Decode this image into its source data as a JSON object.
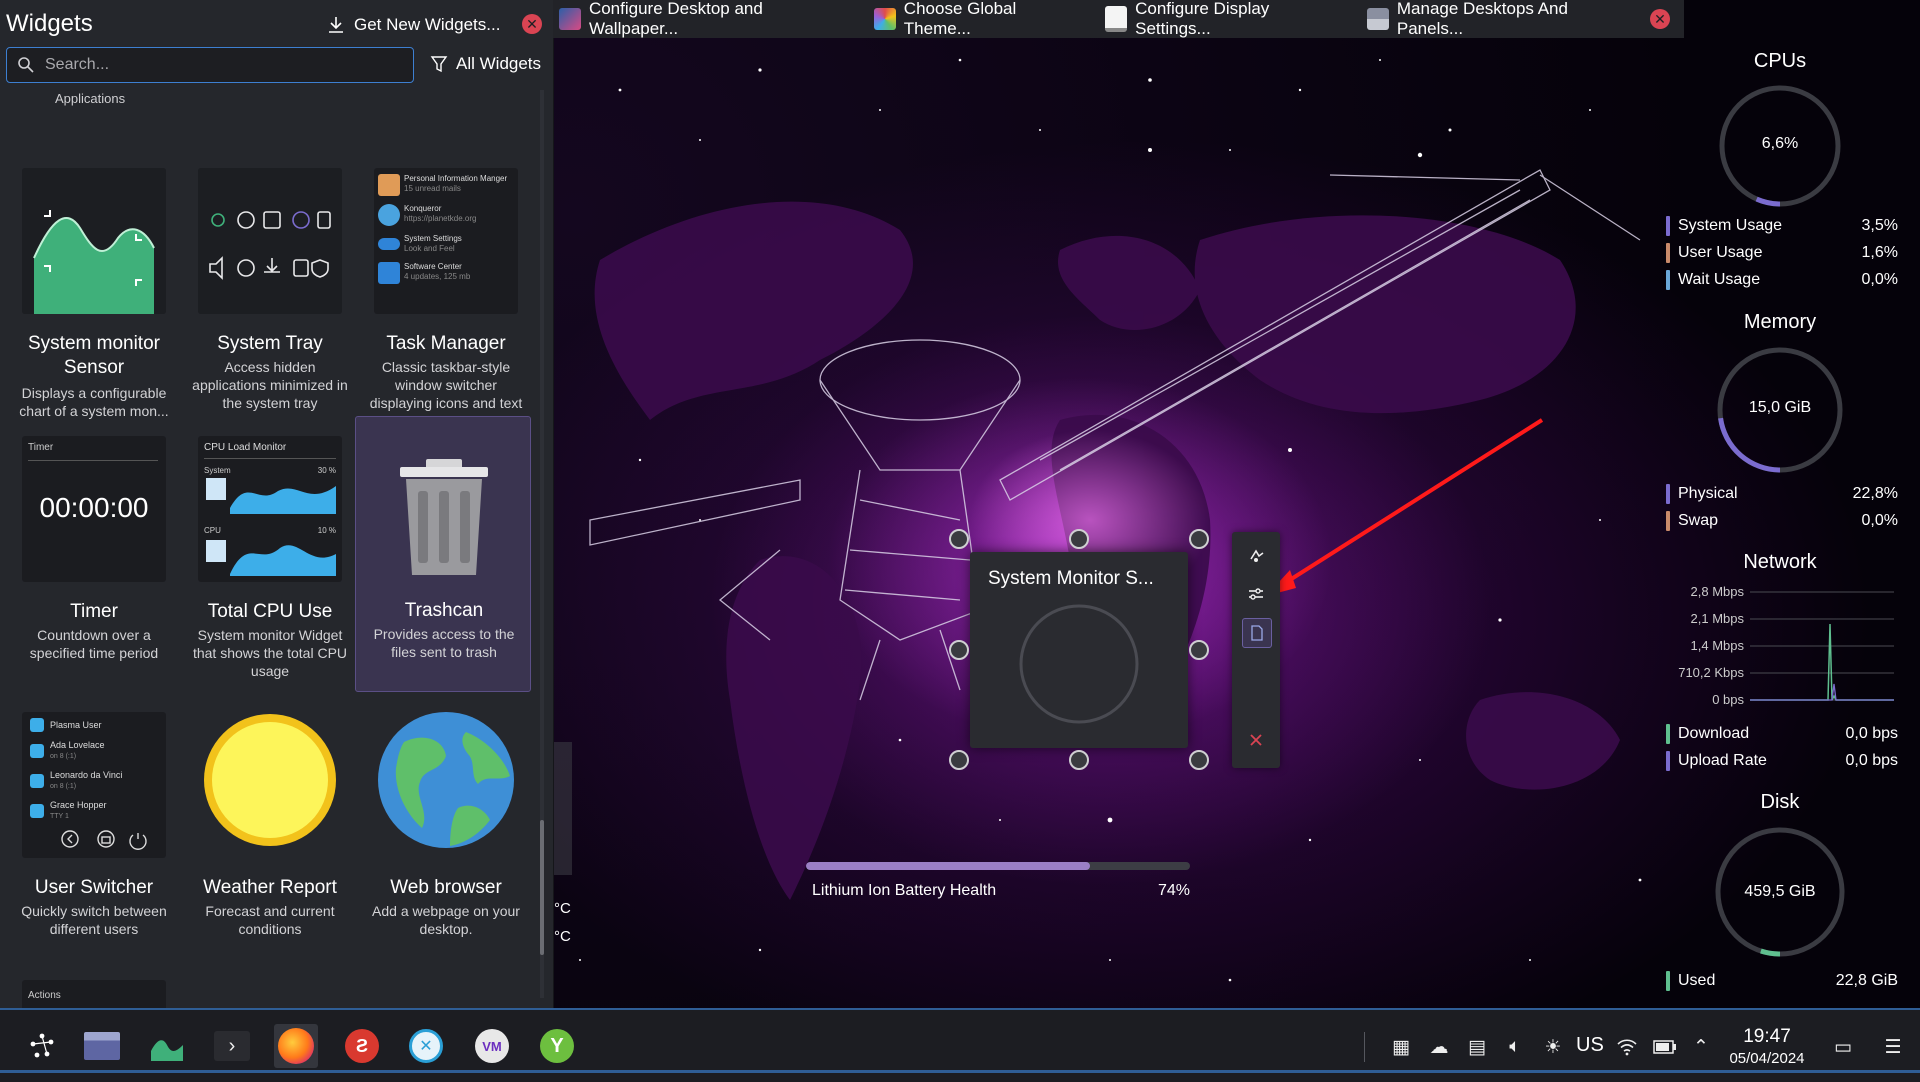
{
  "widgets_panel": {
    "title": "Widgets",
    "get_new_label": "Get New Widgets...",
    "close_symbol": "✕",
    "search_placeholder": "Search...",
    "filter_label": "All Widgets",
    "category_label": "Applications",
    "bottom_category_label": "Actions",
    "tiles": [
      {
        "name": "System monitor Sensor",
        "description": "Displays a configurable chart of a system mon..."
      },
      {
        "name": "System Tray",
        "description": "Access hidden applications minimized in the system tray"
      },
      {
        "name": "Task Manager",
        "description": "Classic taskbar-style window switcher displaying icons and text"
      },
      {
        "name": "Timer",
        "description": "Countdown over a specified time period"
      },
      {
        "name": "Total CPU Use",
        "description": "System monitor Widget that shows the total CPU usage"
      },
      {
        "name": "Trashcan",
        "description": "Provides access to the files sent to trash"
      },
      {
        "name": "User Switcher",
        "description": "Quickly switch between different users"
      },
      {
        "name": "Weather Report",
        "description": "Forecast and current conditions"
      },
      {
        "name": "Web browser",
        "description": "Add a webpage on your desktop."
      }
    ],
    "thumbs": {
      "timer_header": "Timer",
      "timer_value": "00:00:00",
      "cpu_title": "CPU Load Monitor",
      "cpu_system_label": "System",
      "cpu_system_value": "30 %",
      "cpu_cpu_label": "CPU",
      "cpu_cpu_value": "10 %",
      "task_items": [
        {
          "title": "Personal Information Manger",
          "sub": "15 unread mails"
        },
        {
          "title": "Konqueror",
          "sub": "https://planetkde.org"
        },
        {
          "title": "System Settings",
          "sub": "Look and Feel"
        },
        {
          "title": "Software Center",
          "sub": "4 updates, 125 mb"
        }
      ],
      "user_items": [
        {
          "title": "Plasma User",
          "sub": ""
        },
        {
          "title": "Ada Lovelace",
          "sub": "on 8 (:1)"
        },
        {
          "title": "Leonardo da Vinci",
          "sub": "on 8 (:1)"
        },
        {
          "title": "Grace Hopper",
          "sub": "TTY 1"
        }
      ]
    }
  },
  "window_strip": {
    "items": [
      {
        "label": "Configure Desktop and Wallpaper..."
      },
      {
        "label": "Choose Global Theme..."
      },
      {
        "label": "Configure Display Settings..."
      },
      {
        "label": "Manage Desktops And Panels..."
      }
    ],
    "close_symbol": "✕"
  },
  "sensor_widget": {
    "title": "System Monitor S..."
  },
  "battery": {
    "label": "Lithium Ion Battery Health",
    "value_text": "74%",
    "value": 74
  },
  "temp_fragment": [
    "°C",
    "°C"
  ],
  "sysmon": {
    "cpus": {
      "heading": "CPUs",
      "gauge_text": "6,6%",
      "gauge_value": 6.6,
      "rows": [
        {
          "label": "System Usage",
          "value": "3,5%",
          "color": "#7b6ccf"
        },
        {
          "label": "User Usage",
          "value": "1,6%",
          "color": "#c98a6a"
        },
        {
          "label": "Wait Usage",
          "value": "0,0%",
          "color": "#6aa7d8"
        }
      ]
    },
    "memory": {
      "heading": "Memory",
      "gauge_text": "15,0 GiB",
      "gauge_value": 22.8,
      "rows": [
        {
          "label": "Physical",
          "value": "22,8%",
          "color": "#7b6ccf"
        },
        {
          "label": "Swap",
          "value": "0,0%",
          "color": "#c98a6a"
        }
      ]
    },
    "network": {
      "heading": "Network",
      "ticks": [
        "2,8 Mbps",
        "2,1 Mbps",
        "1,4 Mbps",
        "710,2 Kbps",
        "0 bps"
      ],
      "rows": [
        {
          "label": "Download",
          "value": "0,0 bps",
          "color": "#5fbf8f"
        },
        {
          "label": "Upload Rate",
          "value": "0,0 bps",
          "color": "#7b6ccf"
        }
      ]
    },
    "disk": {
      "heading": "Disk",
      "gauge_text": "459,5 GiB",
      "gauge_value": 5,
      "rows": [
        {
          "label": "Used",
          "value": "22,8 GiB",
          "color": "#5fbf8f"
        }
      ]
    }
  },
  "taskbar": {
    "keyboard_layout": "US",
    "clock_time": "19:47",
    "clock_date": "05/04/2024"
  },
  "colors": {
    "accent": "#3d7fd1",
    "close_red": "#da4453",
    "selection": "#3a3450"
  }
}
